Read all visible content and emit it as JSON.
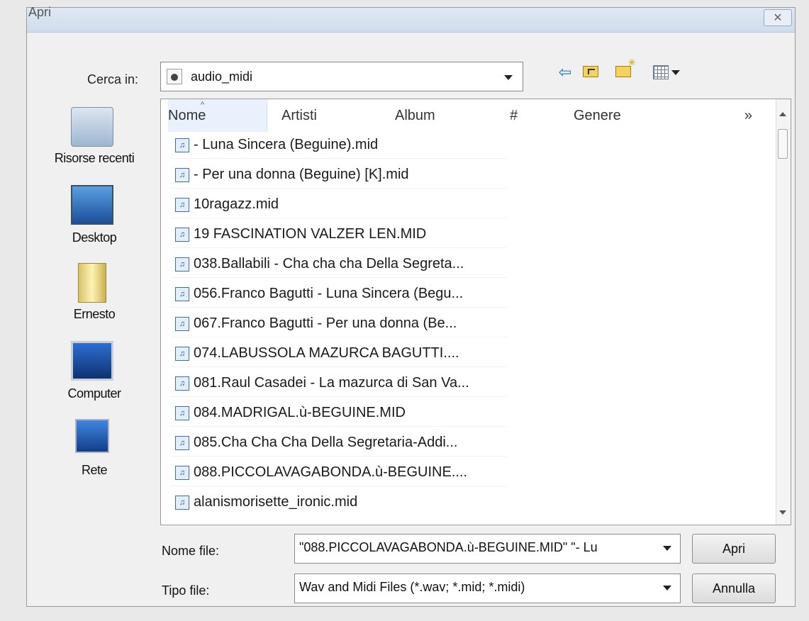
{
  "dialog": {
    "title": "Apri",
    "close_label": "✕"
  },
  "lookin": {
    "label": "Cerca in:",
    "value": "audio_midi"
  },
  "places": [
    {
      "label": "Risorse recenti",
      "icon": "recent-places-icon"
    },
    {
      "label": "Desktop",
      "icon": "desktop-icon"
    },
    {
      "label": "Ernesto",
      "icon": "user-folder-icon"
    },
    {
      "label": "Computer",
      "icon": "computer-icon"
    },
    {
      "label": "Rete",
      "icon": "network-icon"
    }
  ],
  "columns": {
    "nome": "Nome",
    "artisti": "Artisti",
    "album": "Album",
    "numero": "#",
    "genere": "Genere",
    "more": "»"
  },
  "files": [
    "- Luna Sincera (Beguine).mid",
    "- Per una donna (Beguine) [K].mid",
    "10ragazz.mid",
    "19 FASCINATION VALZER LEN.MID",
    "038.Ballabili - Cha cha cha Della Segreta...",
    "056.Franco Bagutti - Luna Sincera (Begu...",
    "067.Franco Bagutti - Per una donna (Be...",
    "074.LABUSSOLA MAZURCA  BAGUTTI....",
    "081.Raul Casadei - La mazurca di San Va...",
    "084.MADRIGAL.ù-BEGUINE.MID",
    "085.Cha Cha Cha Della Segretaria-Addi...",
    "088.PICCOLAVAGABONDA.ù-BEGUINE....",
    "alanismorisette_ironic.mid"
  ],
  "filename": {
    "label": "Nome file:",
    "value": "\"088.PICCOLAVAGABONDA.ù-BEGUINE.MID\" \"- Lu"
  },
  "filetype": {
    "label": "Tipo file:",
    "value": "Wav and Midi Files (*.wav; *.mid; *.midi)"
  },
  "buttons": {
    "open": "Apri",
    "cancel": "Annulla"
  }
}
